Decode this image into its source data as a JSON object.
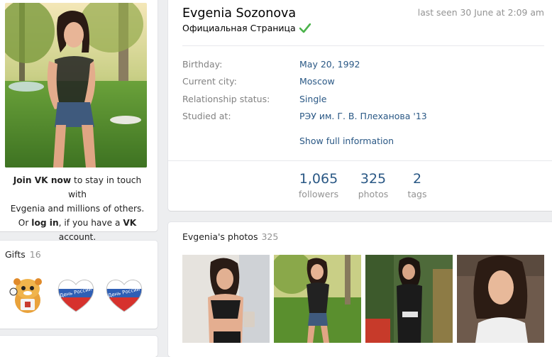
{
  "sidebar": {
    "join_prefix": "Join VK now",
    "join_middle": " to stay in touch with",
    "join_line2": "Evgenia and millions of others.",
    "join_or": "Or ",
    "login": "log in",
    "join_if": ", if you have a ",
    "vk": "VK",
    "join_account": " account.",
    "gifts_title": "Gifts",
    "gifts_count": "16",
    "gift_heart_text": "День России"
  },
  "profile": {
    "name": "Evgenia Sozonova",
    "official_label": "Официальная Страница",
    "last_seen": "last seen 30 June at 2:09 am",
    "info": [
      {
        "label": "Birthday:",
        "value": "May 20, 1992"
      },
      {
        "label": "Current city:",
        "value": "Moscow"
      },
      {
        "label": "Relationship status:",
        "value": "Single"
      },
      {
        "label": "Studied at:",
        "value": "РЭУ им. Г. В. Плеханова '13"
      }
    ],
    "show_full": "Show full information",
    "counters": [
      {
        "num": "1,065",
        "label": "followers"
      },
      {
        "num": "325",
        "label": "photos"
      },
      {
        "num": "2",
        "label": "tags"
      }
    ]
  },
  "photos": {
    "title": "Evgenia's photos",
    "count": "325"
  },
  "colors": {
    "link": "#2a5885",
    "muted": "#939393",
    "background": "#edeef0",
    "verified": "#4bb34b"
  }
}
